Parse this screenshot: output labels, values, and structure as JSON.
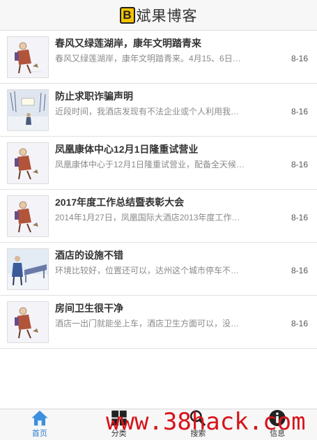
{
  "header": {
    "logo_letter": "B",
    "title": "斌果博客"
  },
  "articles": [
    {
      "title": "春风又绿莲湖岸，康年文明踏青来",
      "summary": "春风又绿莲湖岸，康年文明踏青来。4月15、6日，达...",
      "date": "8-16",
      "thumb": "figure"
    },
    {
      "title": "防止求职诈骗声明",
      "summary": "近段时间，我酒店发现有不法企业或个人利用我酒店...",
      "date": "8-16",
      "thumb": "winter"
    },
    {
      "title": "凤凰康体中心12月1日隆重试营业",
      "summary": "凤凰康体中心于12月1日隆重试营业，配备全天候恒温...",
      "date": "8-16",
      "thumb": "figure"
    },
    {
      "title": "2017年度工作总结暨表彰大会",
      "summary": "2014年1月27日，凤凰国际大酒店2013年度工作总结暨...",
      "date": "8-16",
      "thumb": "figure"
    },
    {
      "title": "酒店的设施不错",
      "summary": "环境比较好，位置还可以，达州这个城市停车不是很...",
      "date": "8-16",
      "thumb": "bench"
    },
    {
      "title": "房间卫生很干净",
      "summary": "酒店一出门就能坐上车，酒店卫生方面可以，没有什...",
      "date": "8-16",
      "thumb": "figure"
    }
  ],
  "tabbar": {
    "items": [
      {
        "label": "首页",
        "icon": "home-icon"
      },
      {
        "label": "分类",
        "icon": "grid-icon"
      },
      {
        "label": "搜索",
        "icon": "search-icon"
      },
      {
        "label": "信息",
        "icon": "info-icon"
      }
    ]
  },
  "watermark": "www.38hack.com",
  "colors": {
    "active_tab": "#2a7ad0",
    "watermark": "#d8141a",
    "logo_box": "#f5c400"
  }
}
